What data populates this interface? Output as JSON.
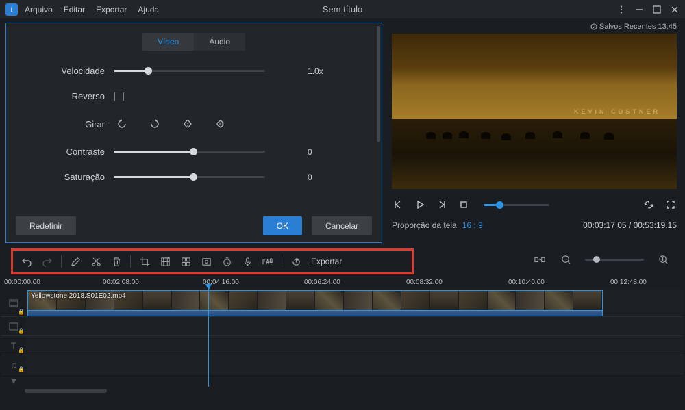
{
  "menu": {
    "file": "Arquivo",
    "edit": "Editar",
    "export": "Exportar",
    "help": "Ajuda"
  },
  "title": "Sem título",
  "saved": "Salvos Recentes 13:45",
  "panel": {
    "tabs": {
      "video": "Vídeo",
      "audio": "Áudio"
    },
    "speed": {
      "label": "Velocidade",
      "value": "1.0x"
    },
    "reverse": {
      "label": "Reverso"
    },
    "rotate": {
      "label": "Girar"
    },
    "contrast": {
      "label": "Contraste",
      "value": "0"
    },
    "saturation": {
      "label": "Saturação",
      "value": "0"
    },
    "reset": "Redefinir",
    "ok": "OK",
    "cancel": "Cancelar"
  },
  "preview": {
    "credit": "KEVIN COSTNER"
  },
  "aspect": {
    "label": "Proporção da tela",
    "value": "16 : 9"
  },
  "time": {
    "current": "00:03:17.05",
    "total": "00:53:19.15"
  },
  "toolbar": {
    "export": "Exportar"
  },
  "ruler": [
    "00:00:00.00",
    "00:02:08.00",
    "00:04:16.00",
    "00:06:24.00",
    "00:08:32.00",
    "00:10:40.00",
    "00:12:48.00"
  ],
  "clip": {
    "name": "Yellowstone.2018.S01E02.mp4"
  }
}
